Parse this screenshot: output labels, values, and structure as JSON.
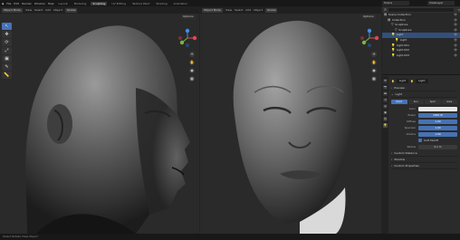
{
  "topbar": {
    "menus": [
      "File",
      "Edit",
      "Render",
      "Window",
      "Help"
    ],
    "workspaces": [
      "Layout",
      "Modeling",
      "Sculpting",
      "UV Editing",
      "Texture Paint",
      "Shading",
      "Animation"
    ],
    "active_workspace": "Sculpting",
    "scene": "Scene",
    "view_layer": "ViewLayer"
  },
  "left_viewport": {
    "mode": "Object Mode",
    "menus": [
      "View",
      "Select",
      "Add",
      "Object"
    ],
    "transform": "Global",
    "options": "Options"
  },
  "right_viewport": {
    "mode": "Object Mode",
    "menus": [
      "View",
      "Select",
      "Add",
      "Object"
    ],
    "transform": "Global",
    "options": "Options"
  },
  "tools": [
    "↖",
    "✥",
    "⟳",
    "⤢",
    "▣",
    "✎",
    "📏"
  ],
  "gizmo_colors": {
    "x": "#e2474f",
    "y": "#7cb342",
    "z": "#3f8ee6"
  },
  "outliner": {
    "title": "Scene Collection",
    "rows": [
      {
        "label": "Scene Collection",
        "icon": "collection-icon",
        "indent": 0,
        "selected": false
      },
      {
        "label": "Collection",
        "icon": "collection-icon",
        "indent": 1,
        "selected": false
      },
      {
        "label": "Sculpture",
        "icon": "mesh-icon",
        "indent": 2,
        "selected": false
      },
      {
        "label": "Sculpture",
        "icon": "mesh-icon",
        "indent": 3,
        "selected": false
      },
      {
        "label": "Light",
        "icon": "light-icon",
        "indent": 2,
        "selected": true
      },
      {
        "label": "Light",
        "icon": "light-icon",
        "indent": 3,
        "selected": false
      },
      {
        "label": "Light.001",
        "icon": "light-icon",
        "indent": 2,
        "selected": false
      },
      {
        "label": "Light.002",
        "icon": "light-icon",
        "indent": 2,
        "selected": false
      },
      {
        "label": "Light.003",
        "icon": "light-icon",
        "indent": 2,
        "selected": false
      }
    ]
  },
  "properties": {
    "object_name": "Light",
    "data_name": "Light",
    "sections": {
      "preview": "Preview",
      "light": "Light",
      "custom_distance": "Custom Distance",
      "shadow": "Shadow",
      "custom_props": "Custom Properties"
    },
    "light_types": [
      "Point",
      "Sun",
      "Spot",
      "Area"
    ],
    "active_light_type": "Point",
    "fields": [
      {
        "label": "Color",
        "value": "",
        "style": "swatch"
      },
      {
        "label": "Power",
        "value": "1000 W",
        "style": "blue"
      },
      {
        "label": "Diffuse",
        "value": "1.00",
        "style": "blue"
      },
      {
        "label": "Specular",
        "value": "1.00",
        "style": "blue"
      },
      {
        "label": "Volume",
        "value": "1.00",
        "style": "blue"
      }
    ],
    "soft_falloff": "Soft Falloff",
    "radius_label": "Radius",
    "radius_value": "0.1 m"
  },
  "statusbar": "Select     Rotate View     Object"
}
